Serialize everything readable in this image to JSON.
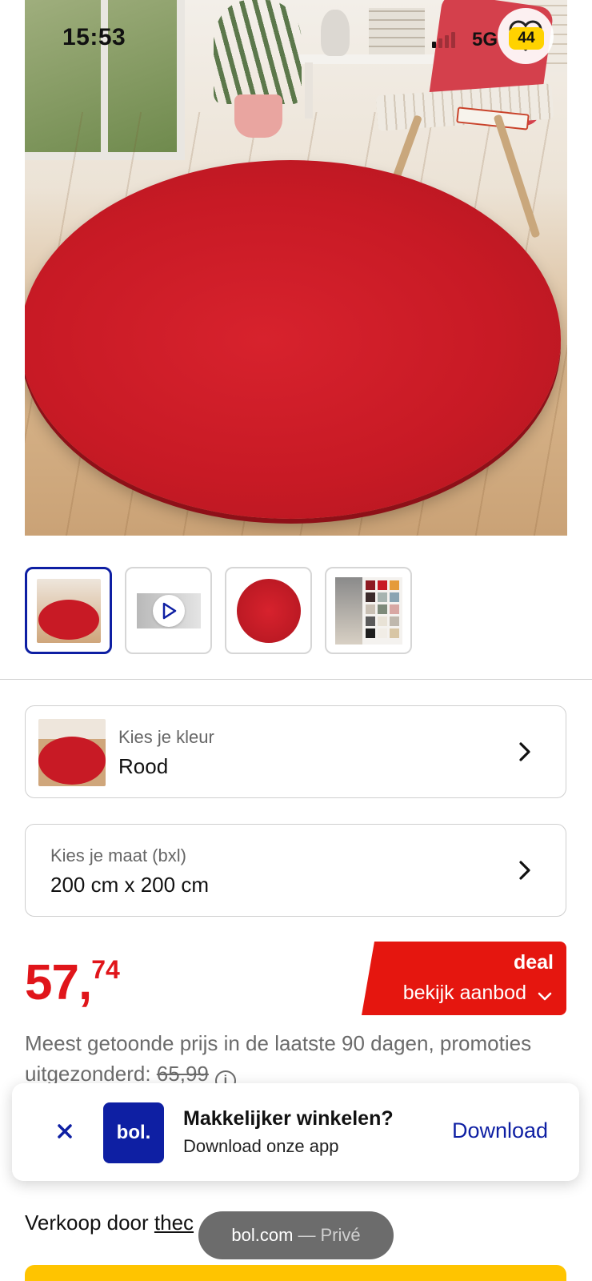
{
  "status_bar": {
    "time": "15:53",
    "network": "5G",
    "battery": "44"
  },
  "gallery": {
    "thumbnails": [
      {
        "name": "room-photo",
        "selected": true
      },
      {
        "name": "video",
        "selected": false
      },
      {
        "name": "rug-topview",
        "selected": false
      },
      {
        "name": "color-swatches",
        "selected": false
      }
    ]
  },
  "color_selector": {
    "label": "Kies je kleur",
    "value": "Rood"
  },
  "size_selector": {
    "label": "Kies je maat (bxl)",
    "value": "200 cm x 200 cm"
  },
  "price": {
    "whole": "57,",
    "cents": "74",
    "color": "#e0151a"
  },
  "deal": {
    "title": "deal",
    "subtitle": "bekijk aanbod"
  },
  "price_note": {
    "text": "Meest getoonde prijs in de laatste 90 dagen, promoties uitgezonderd:",
    "old_price": "65,99"
  },
  "app_banner": {
    "logo": "bol.",
    "title": "Makkelijker winkelen?",
    "subtitle": "Download onze app",
    "action": "Download"
  },
  "seller": {
    "prefix": "Verkoop door",
    "name": "thec"
  },
  "toast": {
    "domain": "bol.com",
    "separator": "—",
    "mode": "Privé"
  },
  "colors": {
    "brand_blue": "#0e1fa3",
    "deal_red": "#e5160f",
    "buy_yellow": "#ffc400"
  }
}
